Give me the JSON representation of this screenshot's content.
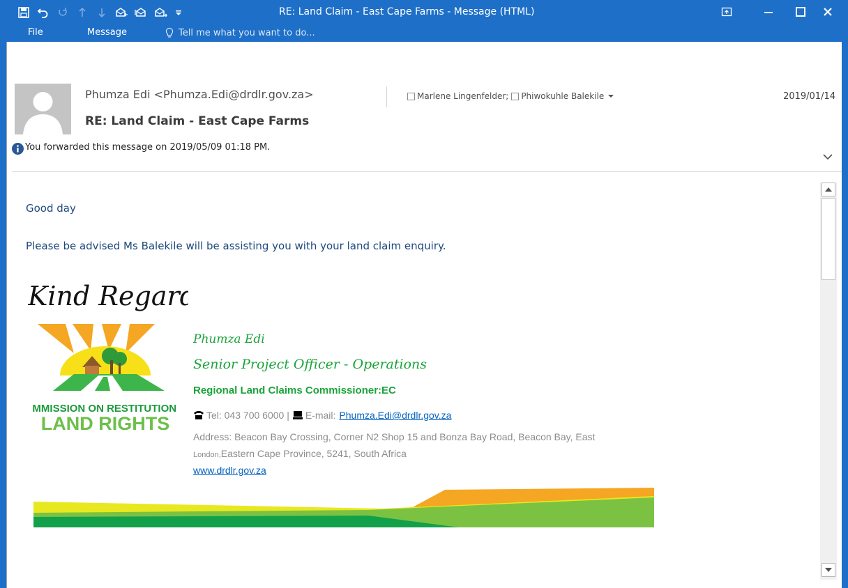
{
  "window": {
    "title": "RE: Land Claim - East Cape Farms - Message (HTML)"
  },
  "ribbon": {
    "tabs": [
      {
        "label": "File"
      },
      {
        "label": "Message"
      }
    ],
    "tell_me": "Tell me what you want to do..."
  },
  "message": {
    "from": "Phumza Edi <Phumza.Edi@drdlr.gov.za>",
    "recipients": [
      "Marlene Lingenfelder;",
      "Phiwokuhle Balekile"
    ],
    "date": "2019/01/14",
    "subject": "RE: Land Claim - East Cape Farms",
    "info": "You forwarded this message on 2019/05/09 01:18 PM."
  },
  "body": {
    "greeting": "Good day",
    "paragraph": "Please be advised Ms Balekile will be assisting you with your land claim enquiry.",
    "closing": "Kind Regards."
  },
  "signature": {
    "name": "Phumza Edi",
    "title": "Senior Project Officer - Operations",
    "org": "Regional Land Claims Commissioner:EC",
    "tel_label": "Tel: 043 700 6000 |",
    "email_label": "E-mail:",
    "email": "Phumza.Edi@drdlr.gov.za",
    "address_line1": "Address:  Beacon Bay Crossing, Corner N2 Shop 15 and Bonza Bay Road, Beacon Bay, East",
    "address_line2_small": "London,",
    "address_line2_rest": "Eastern Cape Province, 5241, South Africa",
    "website": "www.drdlr.gov.za",
    "logo_text_line1": "COMMISSION ON RESTITUTION OF",
    "logo_text_line2": "LAND RIGHTS"
  },
  "colors": {
    "titlebar": "#1e6fc8",
    "body_text": "#1f497d",
    "signature_green": "#1aa33a",
    "link": "#0563c1"
  }
}
